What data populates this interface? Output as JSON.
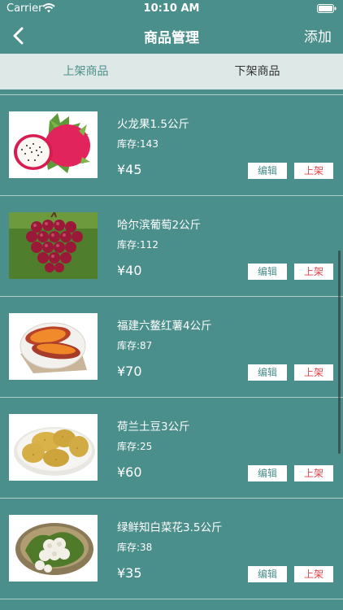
{
  "status_bar": {
    "carrier": "Carrier",
    "time": "10:10 AM",
    "wifi_icon": "wifi-icon",
    "battery_icon": "battery-icon"
  },
  "nav": {
    "title": "商品管理",
    "add_label": "添加",
    "back_icon": "chevron-left-icon"
  },
  "tabs": [
    {
      "label": "上架商品",
      "active": true
    },
    {
      "label": "下架商品",
      "active": false
    }
  ],
  "products": [
    {
      "name": "火龙果1.5公斤",
      "stock": "库存:143",
      "price": "¥45",
      "edit_label": "编辑",
      "shelf_label": "上架",
      "image": "dragon-fruit-image"
    },
    {
      "name": "哈尔滨葡萄2公斤",
      "stock": "库存:112",
      "price": "¥40",
      "edit_label": "编辑",
      "shelf_label": "上架",
      "image": "grapes-image"
    },
    {
      "name": "福建六鳌红薯4公斤",
      "stock": "库存:87",
      "price": "¥70",
      "edit_label": "编辑",
      "shelf_label": "上架",
      "image": "sweet-potato-image"
    },
    {
      "name": "荷兰土豆3公斤",
      "stock": "库存:25",
      "price": "¥60",
      "edit_label": "编辑",
      "shelf_label": "上架",
      "image": "potato-image"
    },
    {
      "name": "绿鲜知白菜花3.5公斤",
      "stock": "库存:38",
      "price": "¥35",
      "edit_label": "编辑",
      "shelf_label": "上架",
      "image": "cauliflower-image"
    }
  ],
  "colors": {
    "background": "#4a8f8b",
    "tab_bar": "#dde8e7",
    "accent": "#4a8f8b",
    "shelf_button_text": "#e0434b"
  }
}
